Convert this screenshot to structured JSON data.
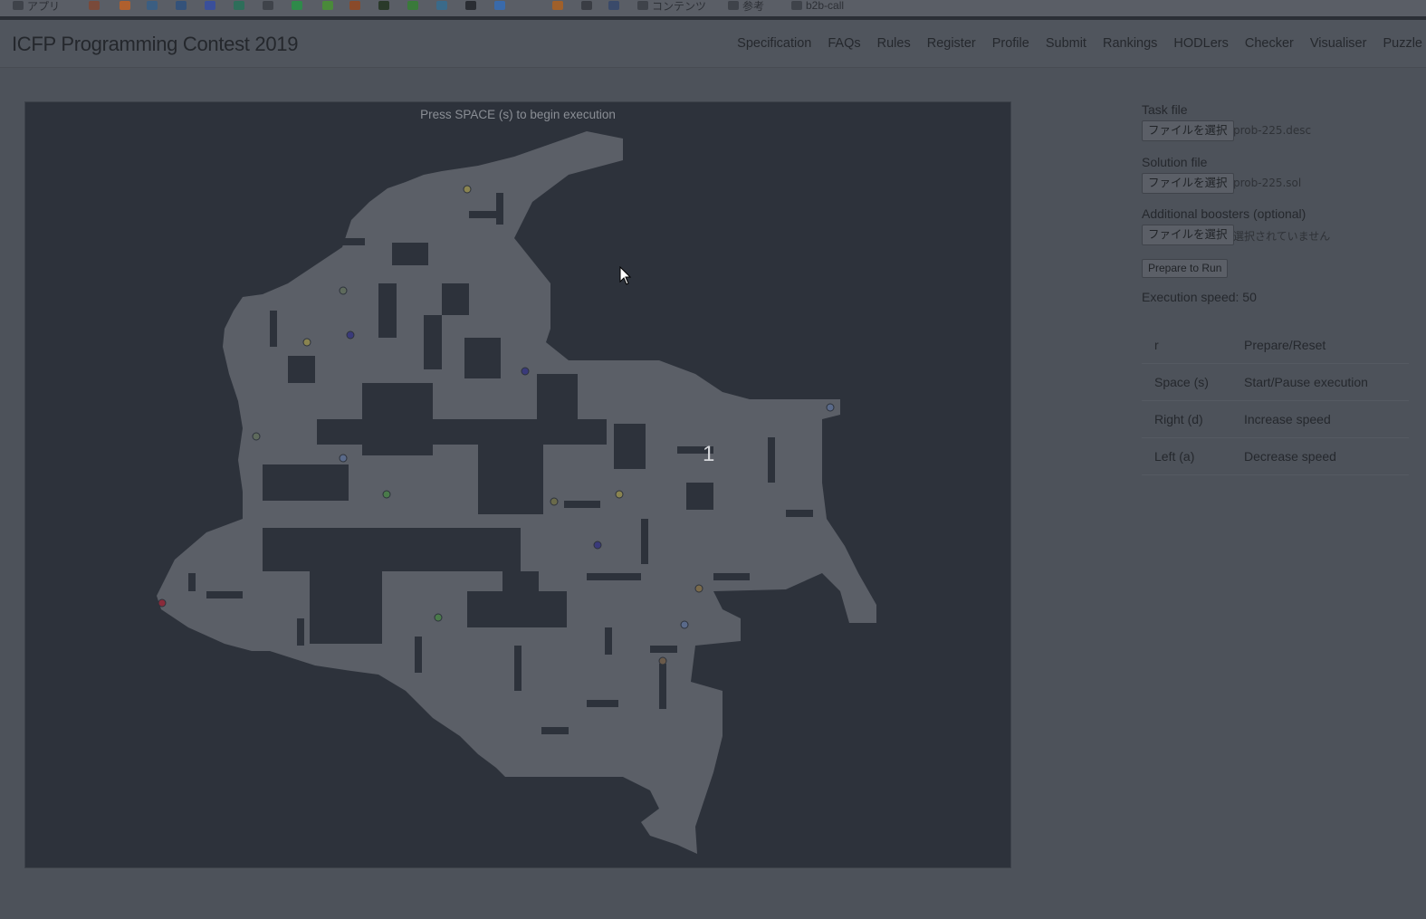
{
  "bookmarks": [
    {
      "label": "アプリ",
      "color": "#3f434a"
    },
    {
      "label": "",
      "color": "#7a4a3a"
    },
    {
      "label": "",
      "color": "#b0602e"
    },
    {
      "label": "",
      "color": "#3b5e82"
    },
    {
      "label": "",
      "color": "#34527a"
    },
    {
      "label": "",
      "color": "#3a4f9a"
    },
    {
      "label": "",
      "color": "#2e6e5a"
    },
    {
      "label": "",
      "color": "#3f434a"
    },
    {
      "label": "",
      "color": "#2f8a4a"
    },
    {
      "label": "",
      "color": "#4a8a3a"
    },
    {
      "label": "",
      "color": "#8a4a2a"
    },
    {
      "label": "",
      "color": "#2a3a2a"
    },
    {
      "label": "",
      "color": "#3a7a3a"
    },
    {
      "label": "",
      "color": "#3a6a8a"
    },
    {
      "label": "",
      "color": "#2a2d33"
    },
    {
      "label": "",
      "color": "#3a6aaa"
    },
    {
      "label": "",
      "color": "#5a5e66"
    },
    {
      "label": "",
      "color": "#a0602a"
    },
    {
      "label": "",
      "color": "#3a3d44"
    },
    {
      "label": "",
      "color": "#3a4a6a"
    },
    {
      "label": "コンテンツ",
      "color": "#3f434a"
    },
    {
      "label": "参考",
      "color": "#3f434a"
    },
    {
      "label": "b2b-call",
      "color": "#3f434a"
    }
  ],
  "header": {
    "title": "ICFP Programming Contest 2019",
    "nav": [
      "Specification",
      "FAQs",
      "Rules",
      "Register",
      "Profile",
      "Submit",
      "Rankings",
      "HODLers",
      "Checker",
      "Visualiser",
      "Puzzle"
    ]
  },
  "canvas": {
    "hint": "Press SPACE (s) to begin execution",
    "robot_label": "1",
    "colors": {
      "background": "#2d323b",
      "floor": "#5b5f67",
      "obstacle": "#2d323b"
    }
  },
  "panel": {
    "task_label": "Task file",
    "task_button": "ファイルを選択",
    "task_file": "prob-225.desc",
    "solution_label": "Solution file",
    "solution_button": "ファイルを選択",
    "solution_file": "prob-225.sol",
    "boosters_label": "Additional boosters (optional)",
    "boosters_button": "ファイルを選択",
    "boosters_file": "選択されていません",
    "prepare_button": "Prepare to Run",
    "speed": "Execution speed: 50",
    "keys": [
      {
        "key": "r",
        "action": "Prepare/Reset"
      },
      {
        "key": "Space (s)",
        "action": "Start/Pause execution"
      },
      {
        "key": "Right (d)",
        "action": "Increase speed"
      },
      {
        "key": "Left (a)",
        "action": "Decrease speed"
      }
    ]
  }
}
